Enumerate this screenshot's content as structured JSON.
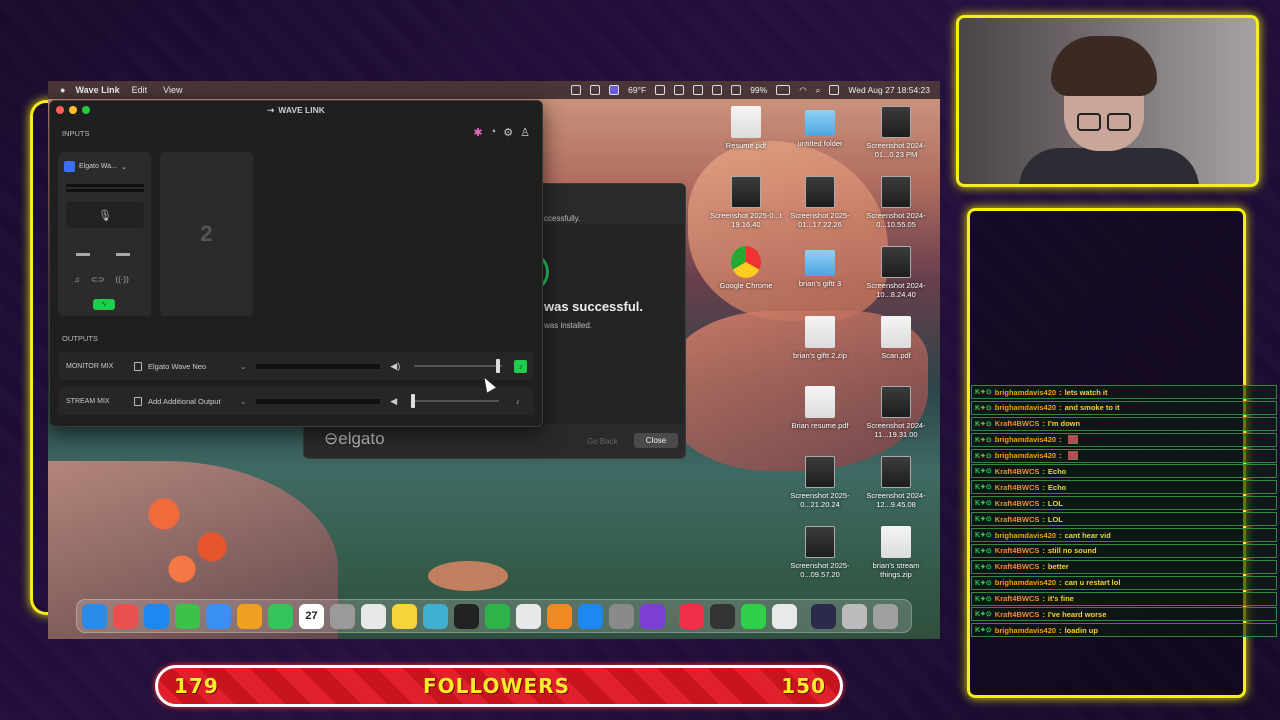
{
  "menubar": {
    "app": "Wave Link",
    "edit": "Edit",
    "view": "View",
    "weather": "69°F",
    "battery": "99%",
    "datetime": "Wed Aug 27  18:54:23"
  },
  "wavelink": {
    "title": "WAVE LINK",
    "inputs_label": "INPUTS",
    "input_device": "Elgato Wa...",
    "empty_slot": "2",
    "outputs_label": "OUTPUTS",
    "outputs": [
      {
        "label": "MONITOR MIX",
        "device": "Elgato Wave Neo",
        "level": 0.97,
        "ear_color": "#1fcc4d"
      },
      {
        "label": "STREAM MIX",
        "device": "Add Additional Output",
        "level": 0.0,
        "ear_color": "transparent"
      }
    ]
  },
  "installer": {
    "t1": "ccessfully.",
    "t2": "was successful.",
    "t3": "was installed.",
    "brand": "elgato",
    "back": "Go Back",
    "close": "Close"
  },
  "desktop_icons": [
    {
      "label": "Resume.pdf",
      "kind": "file"
    },
    {
      "label": "untitled folder",
      "kind": "folder"
    },
    {
      "label": "Screenshot 2024-01...0.23 PM",
      "kind": "shot"
    },
    {
      "label": "Screenshot 2025-0...t 19.16.40",
      "kind": "shot"
    },
    {
      "label": "Screenshot 2025-01...17.22.26",
      "kind": "shot"
    },
    {
      "label": "Screenshot 2024-0...10.55.05",
      "kind": "shot"
    },
    {
      "label": "Google Chrome",
      "kind": "chrome"
    },
    {
      "label": "brian's giftt 3",
      "kind": "folder"
    },
    {
      "label": "Screenshot 2024-10...8.24.40",
      "kind": "shot"
    },
    {
      "label": "brian's giftt 2.zip",
      "kind": "file"
    },
    {
      "label": "Scan.pdf",
      "kind": "file"
    },
    {
      "label": "Brian resume.pdf",
      "kind": "file"
    },
    {
      "label": "Screenshot 2024-11...19.31.00",
      "kind": "shot"
    },
    {
      "label": "Screenshot 2025-0...21.20.24",
      "kind": "shot"
    },
    {
      "label": "Screenshot 2024-12...9.45.08",
      "kind": "shot"
    },
    {
      "label": "Screenshot 2025-0...09.57.20",
      "kind": "shot"
    },
    {
      "label": "brian's stream things.zip",
      "kind": "file"
    }
  ],
  "dock_colors": [
    "#2a8be8",
    "#e95050",
    "#1c88f0",
    "#3cc24a",
    "#3b90f5",
    "#f0a020",
    "#32c65a",
    "#ffffff",
    "#9a9a9a",
    "#e8e8e8",
    "#f5d33a",
    "#3fb0d0",
    "#222222",
    "#2db34a",
    "#e8e8e8",
    "#f08a24",
    "#1e88f0",
    "#8a8a8a",
    "#7b3fd6",
    "#f0304a",
    "#333333",
    "#2fcf4a",
    "#e9e9e9",
    "#2a2a4a",
    "#bbbbbb",
    "#a0a0a0"
  ],
  "dock_date": "27",
  "chat": [
    {
      "user": "brighamdavis420",
      "text": "lets watch it"
    },
    {
      "user": "brighamdavis420",
      "text": "and smoke to it"
    },
    {
      "user": "Kraft4BWCS",
      "text": "I'm down"
    },
    {
      "user": "brighamdavis420",
      "text": ""
    },
    {
      "user": "brighamdavis420",
      "text": ""
    },
    {
      "user": "Kraft4BWCS",
      "text": "Echo"
    },
    {
      "user": "Kraft4BWCS",
      "text": "Echo"
    },
    {
      "user": "Kraft4BWCS",
      "text": "LOL"
    },
    {
      "user": "Kraft4BWCS",
      "text": "LOL"
    },
    {
      "user": "brighamdavis420",
      "text": "cant hear vid"
    },
    {
      "user": "Kraft4BWCS",
      "text": "still no sound"
    },
    {
      "user": "Kraft4BWCS",
      "text": "better"
    },
    {
      "user": "brighamdavis420",
      "text": "can u restart lol"
    },
    {
      "user": "Kraft4BWCS",
      "text": "it's fine"
    },
    {
      "user": "Kraft4BWCS",
      "text": "I've heard worse"
    },
    {
      "user": "brighamdavis420",
      "text": "loadin up"
    }
  ],
  "followers": {
    "left": "179",
    "label": "FOLLOWERS",
    "right": "150"
  },
  "colors": {
    "accent": "#f4ee1a",
    "bar": "#e0202a"
  }
}
